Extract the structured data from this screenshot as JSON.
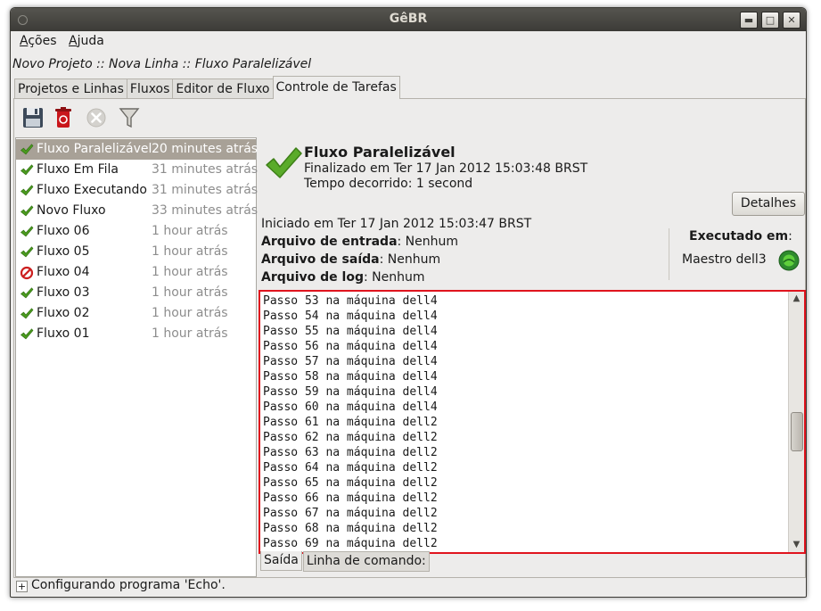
{
  "window": {
    "title": "GêBR"
  },
  "menu": [
    {
      "accel": "A",
      "rest": "ções"
    },
    {
      "accel": "A",
      "rest": "juda"
    }
  ],
  "breadcrumb": "Novo Projeto :: Nova Linha :: Fluxo Paralelizável",
  "tabs": [
    "Projetos e Linhas",
    "Fluxos",
    "Editor de Fluxo",
    "Controle de Tarefas"
  ],
  "active_tab": "Controle de Tarefas",
  "toolbar": [
    "save-icon",
    "delete-icon",
    "cancel-icon",
    "filter-icon"
  ],
  "jobs": [
    {
      "name": "Fluxo Paralelizável",
      "time": "20 minutes atrás",
      "status": "finished",
      "selected": true
    },
    {
      "name": "Fluxo Em Fila",
      "time": "31 minutes atrás",
      "status": "finished"
    },
    {
      "name": "Fluxo Executando",
      "time": "31 minutes atrás",
      "status": "finished"
    },
    {
      "name": "Novo Fluxo",
      "time": "33 minutes atrás",
      "status": "finished"
    },
    {
      "name": "Fluxo 06",
      "time": "1 hour atrás",
      "status": "finished"
    },
    {
      "name": "Fluxo 05",
      "time": "1 hour atrás",
      "status": "finished"
    },
    {
      "name": "Fluxo 04",
      "time": "1 hour atrás",
      "status": "canceled"
    },
    {
      "name": "Fluxo 03",
      "time": "1 hour atrás",
      "status": "finished"
    },
    {
      "name": "Fluxo 02",
      "time": "1 hour atrás",
      "status": "finished"
    },
    {
      "name": "Fluxo 01",
      "time": "1 hour atrás",
      "status": "finished"
    }
  ],
  "detail": {
    "title": "Fluxo Paralelizável",
    "finished": "Finalizado em Ter 17 Jan 2012 15:03:48 BRST",
    "elapsed": "Tempo decorrido: 1 second",
    "details_button": "Detalhes",
    "started": "Iniciado em Ter 17 Jan 2012 15:03:47 BRST",
    "input": {
      "label": "Arquivo de entrada",
      "value": ": Nenhum"
    },
    "output": {
      "label": "Arquivo de saída",
      "value": ": Nenhum"
    },
    "log": {
      "label": "Arquivo de log",
      "value": ": Nenhum"
    },
    "executed_label": "Executado em",
    "executed_colon": ":",
    "executed_host": "Maestro dell3"
  },
  "log_lines": [
    "Passo 53 na máquina dell4",
    "Passo 54 na máquina dell4",
    "Passo 55 na máquina dell4",
    "Passo 56 na máquina dell4",
    "Passo 57 na máquina dell4",
    "Passo 58 na máquina dell4",
    "Passo 59 na máquina dell4",
    "Passo 60 na máquina dell4",
    "Passo 61 na máquina dell2",
    "Passo 62 na máquina dell2",
    "Passo 63 na máquina dell2",
    "Passo 64 na máquina dell2",
    "Passo 65 na máquina dell2",
    "Passo 66 na máquina dell2",
    "Passo 67 na máquina dell2",
    "Passo 68 na máquina dell2",
    "Passo 69 na máquina dell2"
  ],
  "log_scroll_position": 0.55,
  "subtabs": [
    "Saída",
    "Linha de comando:"
  ],
  "status": "Configurando programa 'Echo'.",
  "colors": {
    "accent_check": "#4a9a1e",
    "cancel_red": "#cc1f1f",
    "highlight": "#e0141e",
    "selected_row": "#a8a197"
  }
}
